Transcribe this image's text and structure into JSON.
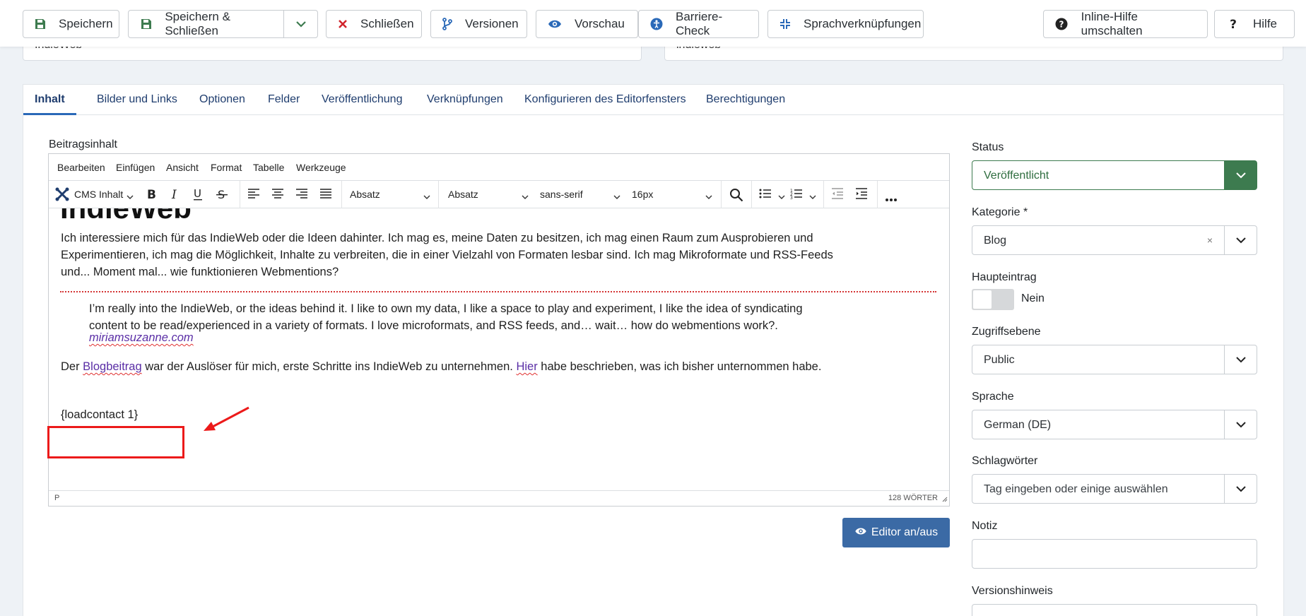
{
  "toolbar": {
    "save": "Speichern",
    "save_close": "Speichern & Schließen",
    "close": "Schließen",
    "versions": "Versionen",
    "preview": "Vorschau",
    "accessibility": "Barriere-Check",
    "associations": "Sprachverknüpfungen",
    "inline_help": "Inline-Hilfe umschalten",
    "help": "Hilfe"
  },
  "top_fields": {
    "left": "IndieWeb",
    "right": "indieweb"
  },
  "tabs": [
    "Inhalt",
    "Bilder und Links",
    "Optionen",
    "Felder",
    "Veröffentlichung",
    "Verknüpfungen",
    "Konfigurieren des Editorfensters",
    "Berechtigungen"
  ],
  "editor": {
    "label": "Beitragsinhalt",
    "menu": [
      "Bearbeiten",
      "Einfügen",
      "Ansicht",
      "Format",
      "Tabelle",
      "Werkzeuge"
    ],
    "cms_content": "CMS Inhalt",
    "block_format": "Absatz",
    "block_format2": "Absatz",
    "font_family": "sans-serif",
    "font_size": "16px",
    "heading": "IndieWeb",
    "para1_line1": "Ich interessiere mich für das IndieWeb oder die Ideen dahinter. Ich mag es, meine Daten zu besitzen, ich mag einen Raum zum Ausprobieren und",
    "para1_line2": "Experimentieren, ich mag die Möglichkeit, Inhalte zu verbreiten, die in einer Vielzahl von Formaten lesbar sind. Ich mag Mikroformate und RSS-Feeds",
    "para1_line3": "und... Moment mal... wie funktionieren Webmentions?",
    "quote_line1": "I’m really into the IndieWeb, or the ideas behind it. I like to own my data, I like a space to play and experiment, I like the idea of syndicating",
    "quote_line2": "content to be read/experienced in a variety of formats. I love microformats, and RSS feeds, and… wait… how do webmentions work?.",
    "quote_source": "miriamsuzanne.com",
    "para2_a": "Der ",
    "para2_link1": "Blogbeitrag",
    "para2_b": " war der Auslöser für mich, erste Schritte ins IndieWeb zu unternehmen. ",
    "para2_link2": "Hier",
    "para2_c": " habe beschrieben, was ich bisher unternommen habe.",
    "loadcontact": "{loadcontact 1}",
    "status_path": "P",
    "word_count": "128 WÖRTER",
    "toggle_button": "Editor an/aus"
  },
  "sidebar": {
    "status_label": "Status",
    "status_value": "Veröffentlicht",
    "category_label": "Kategorie *",
    "category_value": "Blog",
    "category_clear": "×",
    "featured_label": "Haupteintrag",
    "featured_value": "Nein",
    "access_label": "Zugriffsebene",
    "access_value": "Public",
    "language_label": "Sprache",
    "language_value": "German (DE)",
    "tags_label": "Schlagwörter",
    "tags_placeholder": "Tag eingeben oder einige auswählen",
    "note_label": "Notiz",
    "version_note_label": "Versionshinweis"
  },
  "colors": {
    "primary": "#3b6aa5",
    "success": "#3d7b4f",
    "annotation": "#ec1a1a"
  }
}
